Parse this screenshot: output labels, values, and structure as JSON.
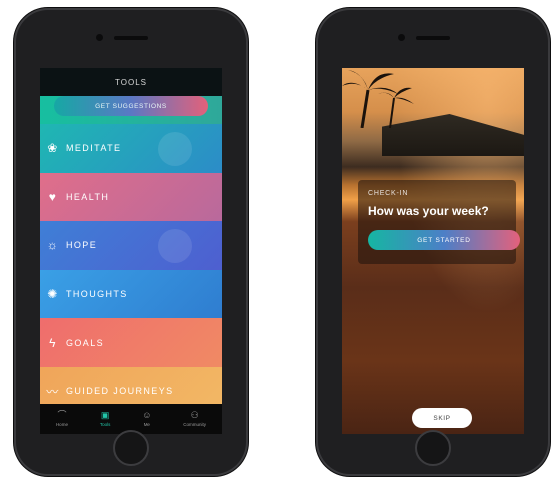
{
  "left": {
    "header": {
      "title": "TOOLS"
    },
    "suggest_button": {
      "label": "GET SUGGESTIONS"
    },
    "tiles": [
      {
        "label": "MEDITATE",
        "icon": "lotus-icon"
      },
      {
        "label": "HEALTH",
        "icon": "heart-icon"
      },
      {
        "label": "HOPE",
        "icon": "sun-icon"
      },
      {
        "label": "THOUGHTS",
        "icon": "lightbulb-icon"
      },
      {
        "label": "GOALS",
        "icon": "lightning-icon"
      },
      {
        "label": "GUIDED JOURNEYS",
        "icon": "path-icon"
      }
    ],
    "tabs": [
      {
        "label": "Home",
        "icon": "home-icon"
      },
      {
        "label": "Tools",
        "icon": "briefcase-icon",
        "active": true
      },
      {
        "label": "Me",
        "icon": "person-icon"
      },
      {
        "label": "Community",
        "icon": "community-icon"
      }
    ]
  },
  "right": {
    "checkin": {
      "label": "CHECK-IN",
      "title": "How was your week?",
      "button_label": "GET STARTED"
    },
    "skip_button": {
      "label": "SKIP"
    }
  },
  "colors": {
    "accent_teal": "#17bfa0",
    "gradient_pink": "#e3617a",
    "meditate": "#1fb7b2",
    "health": "#e06e8a",
    "hope": "#3f7fd6",
    "thoughts": "#3aa0e6",
    "goals": "#ef6d6d",
    "guided": "#f0a55a"
  }
}
